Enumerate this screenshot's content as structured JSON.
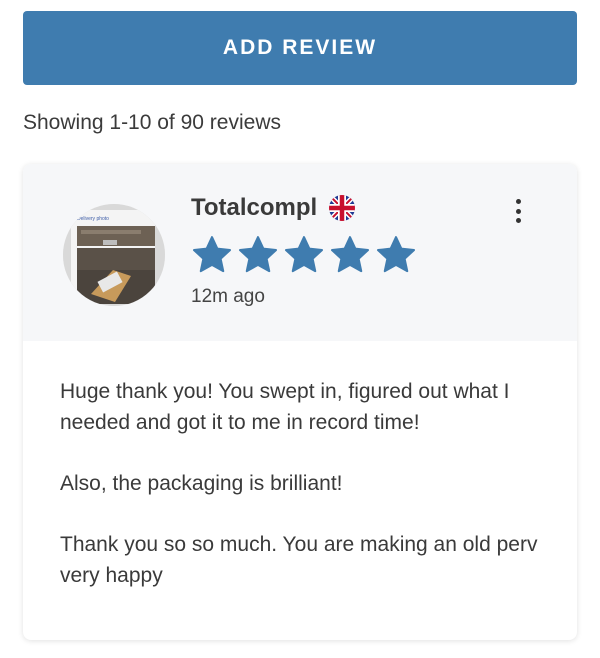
{
  "add_review_label": "ADD REVIEW",
  "showing_text": "Showing 1-10 of 90 reviews",
  "review": {
    "reviewer_name": "Totalcompl",
    "flag_icon": "uk-flag-icon",
    "rating": 5,
    "rating_max": 5,
    "time_ago": "12m ago",
    "avatar_caption": "Delivery photo",
    "paragraphs": [
      "Huge thank you! You swept in, figured out what I needed and got it to me in record time!",
      "Also, the packaging is brilliant!",
      "Thank you so so much. You are making an old perv very happy"
    ]
  },
  "colors": {
    "accent": "#3f7caf",
    "star": "#3f7caf",
    "header_bg": "#f6f7f9"
  }
}
